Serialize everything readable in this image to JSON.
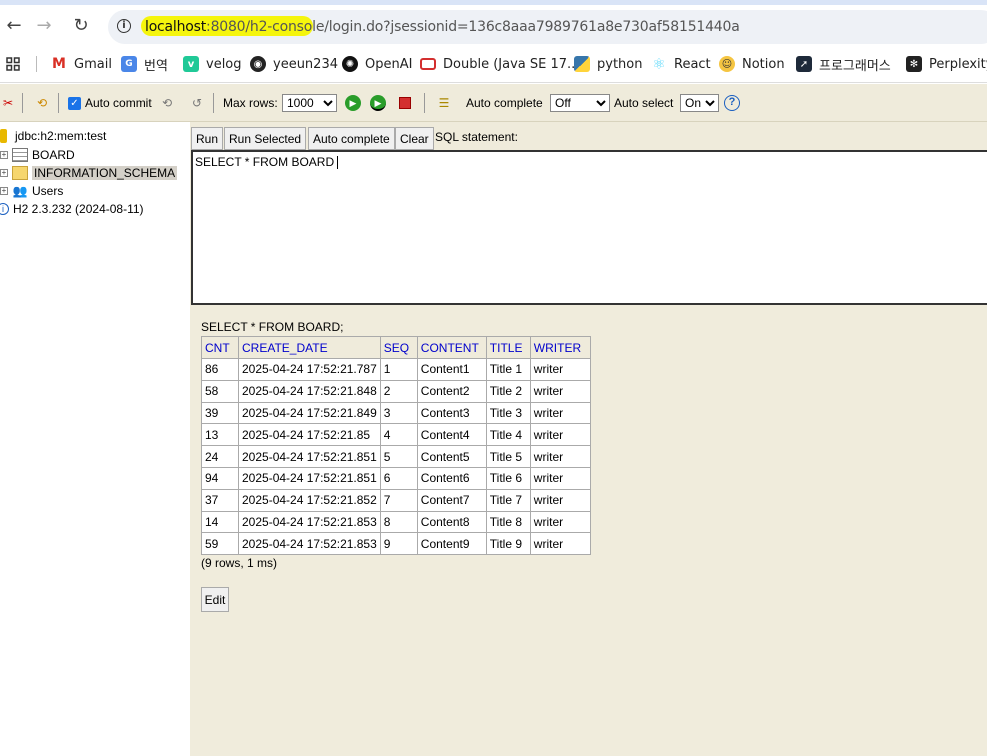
{
  "browser": {
    "url_host": "localhost",
    "url_port_path": ":8080/h2-console",
    "url_rest": "/login.do?jsessionid=136c8aaa7989761a8e730af58151440a",
    "highlight_color": "#f4f400",
    "bookmarks": [
      {
        "label": "Gmail",
        "icon": "gmail-icon"
      },
      {
        "label": "번역",
        "icon": "translate-icon"
      },
      {
        "label": "velog",
        "icon": "velog-icon"
      },
      {
        "label": "yeeun234",
        "icon": "github-icon"
      },
      {
        "label": "OpenAI",
        "icon": "openai-icon"
      },
      {
        "label": "Double (Java SE 17...",
        "icon": "oracle-icon"
      },
      {
        "label": "python",
        "icon": "python-icon"
      },
      {
        "label": "React",
        "icon": "react-icon"
      },
      {
        "label": "Notion",
        "icon": "notion-icon"
      },
      {
        "label": "프로그래머스",
        "icon": "programmers-icon"
      },
      {
        "label": "Perplexity",
        "icon": "perplexity-icon"
      }
    ]
  },
  "toolbar": {
    "auto_commit_label": "Auto commit",
    "auto_commit_checked": true,
    "max_rows_label": "Max rows:",
    "max_rows_value": "1000",
    "auto_complete_label": "Auto complete",
    "auto_complete_value": "Off",
    "auto_select_label": "Auto select",
    "auto_select_value": "On",
    "help_glyph": "?"
  },
  "tree": {
    "connection": "jdbc:h2:mem:test",
    "items": [
      "BOARD",
      "INFORMATION_SCHEMA",
      "Users"
    ],
    "version": "H2 2.3.232 (2024-08-11)"
  },
  "editor": {
    "buttons": {
      "run": "Run",
      "run_selected": "Run Selected",
      "auto_complete": "Auto complete",
      "clear": "Clear"
    },
    "sql_label": "SQL statement:",
    "sql_text": "SELECT * FROM BOARD"
  },
  "result": {
    "query": "SELECT * FROM BOARD;",
    "columns": [
      "CNT",
      "CREATE_DATE",
      "SEQ",
      "CONTENT",
      "TITLE",
      "WRITER"
    ],
    "rows": [
      [
        "86",
        "2025-04-24 17:52:21.787",
        "1",
        "Content1",
        "Title 1",
        "writer"
      ],
      [
        "58",
        "2025-04-24 17:52:21.848",
        "2",
        "Content2",
        "Title 2",
        "writer"
      ],
      [
        "39",
        "2025-04-24 17:52:21.849",
        "3",
        "Content3",
        "Title 3",
        "writer"
      ],
      [
        "13",
        "2025-04-24 17:52:21.85",
        "4",
        "Content4",
        "Title 4",
        "writer"
      ],
      [
        "24",
        "2025-04-24 17:52:21.851",
        "5",
        "Content5",
        "Title 5",
        "writer"
      ],
      [
        "94",
        "2025-04-24 17:52:21.851",
        "6",
        "Content6",
        "Title 6",
        "writer"
      ],
      [
        "37",
        "2025-04-24 17:52:21.852",
        "7",
        "Content7",
        "Title 7",
        "writer"
      ],
      [
        "14",
        "2025-04-24 17:52:21.853",
        "8",
        "Content8",
        "Title 8",
        "writer"
      ],
      [
        "59",
        "2025-04-24 17:52:21.853",
        "9",
        "Content9",
        "Title 9",
        "writer"
      ]
    ],
    "row_count": "(9 rows, 1 ms)",
    "edit_label": "Edit"
  }
}
